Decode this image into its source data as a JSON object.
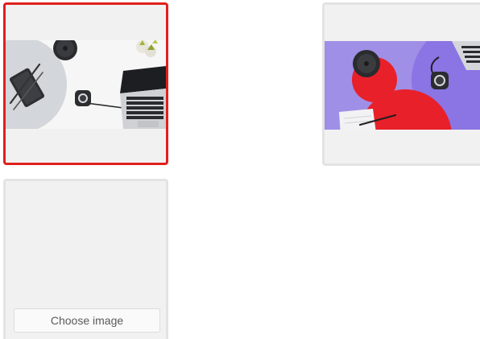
{
  "gallery": {
    "tiles": [
      {
        "name": "image-tile-product-desk",
        "selected": true,
        "image": "desk-with-tablet-laptop-puck-and-plants"
      },
      {
        "name": "image-tile-product-purple",
        "selected": false,
        "image": "purple-background-with-red-circles-puck-and-laptop"
      },
      {
        "name": "image-tile-empty",
        "selected": false,
        "image": null
      }
    ],
    "choose_image_label": "Choose image"
  },
  "colors": {
    "selected_border": "#e1201c",
    "tile_border": "#e3e3e3",
    "tile_background": "#f1f1f1"
  }
}
